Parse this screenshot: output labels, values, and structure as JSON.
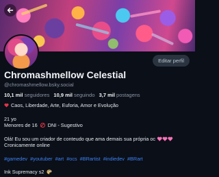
{
  "profile": {
    "display_name": "Chromashmellow Celestial",
    "handle": "@chromashmellow.bsky.social",
    "edit_button": "Editar perfil",
    "stats": {
      "followers_count": "10,1 mil",
      "followers_label": "seguidores",
      "following_count": "10,9 mil",
      "following_label": "seguindo",
      "posts_count": "3,7 mil",
      "posts_label": "postagens"
    },
    "bio": {
      "tagline": "Caos, Liberdade, Arte, Euforia, Amor e Evolução",
      "age": "21 yo",
      "minors_prefix": "Menores de 16",
      "minors_suffix": "DNI - Sugestivo",
      "intro_line1": "Olá! Eu sou um criador de conteudo que ama demais sua própria oc",
      "intro_line2": "Cronicamente online",
      "hashtags": [
        "#gamedev",
        "#youtuber",
        "#art",
        "#ocs",
        "#BRartist",
        "#indiedev",
        "#BRart"
      ],
      "closing": "Ink Supremacy s2"
    }
  },
  "icons": {
    "back": "arrow-left-icon",
    "heart": "heart-icon",
    "no_entry": "no-entry-icon",
    "hearts": "pink-hearts-icon",
    "palette": "palette-icon"
  },
  "colors": {
    "background": "#0b0f17",
    "link": "#3b82f6",
    "heart": "#e0344b",
    "button_bg": "#2a3340",
    "muted_text": "#8b96a8"
  }
}
